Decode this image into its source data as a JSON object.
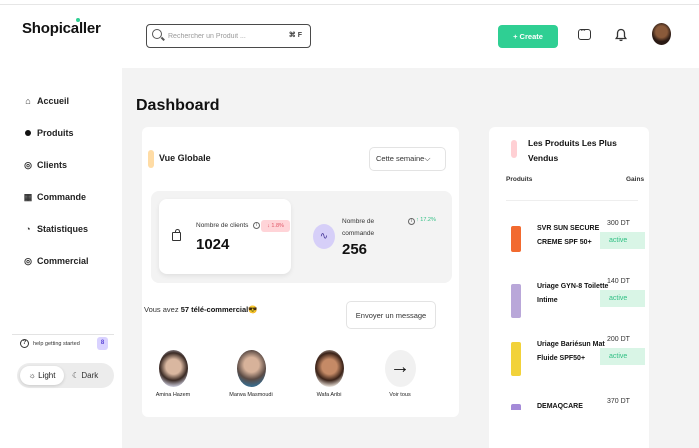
{
  "app": {
    "logo": "Shopicaller"
  },
  "sidebar": {
    "items": [
      {
        "label": "Accueil",
        "icon": "home-icon",
        "glyph": "⌂"
      },
      {
        "label": "Produits",
        "icon": "box-icon",
        "glyph": ""
      },
      {
        "label": "Clients",
        "icon": "user-icon",
        "glyph": "◎"
      },
      {
        "label": "Commande",
        "icon": "cart-icon",
        "glyph": "▦"
      },
      {
        "label": "Statistiques",
        "icon": "chart-icon",
        "glyph": "◔"
      },
      {
        "label": "Commercial",
        "icon": "person-icon",
        "glyph": "◎"
      }
    ],
    "active": "Produits",
    "help_label": "help getting started",
    "help_badge": "8",
    "theme_light": "☼ Light",
    "theme_dark": "☾ Dark"
  },
  "header": {
    "search_placeholder": "Rechercher un Produit ...",
    "search_shortcut": "⌘ F",
    "create_label": "+ Create"
  },
  "main": {
    "title": "Dashboard",
    "overview": {
      "title": "Vue Globale",
      "period": "Cette semaine",
      "stat1_label": "Nombre de clients",
      "stat1_change": "↓ 1.8%",
      "stat1_value": "1024",
      "stat2_label": "Nombre de commande",
      "stat2_change": "↑ 17.2%",
      "stat2_value": "256"
    },
    "tele": {
      "prefix": "Vous avez ",
      "count": "57 télé-commercial",
      "emoji": "😎"
    },
    "send_message": "Envoyer un message",
    "people": [
      {
        "name": "Amina Hazem"
      },
      {
        "name": "Marwa Masmoudi"
      },
      {
        "name": "Wafa Aribi"
      }
    ],
    "see_all": "Voir tous",
    "see_all_glyph": "→"
  },
  "products": {
    "title": "Les Produits Les Plus Vendus",
    "col_products": "Produits",
    "col_gains": "Gains",
    "items": [
      {
        "name": "SVR SUN SECURE CREME SPF 50+",
        "price": "300 DT",
        "status": "active",
        "color": "#f26a2f"
      },
      {
        "name": "Uriage GYN-8 Toilette Intime",
        "price": "140 DT",
        "status": "active",
        "color": "#b9a7d9"
      },
      {
        "name": "Uriage Bariésun Mat Fluide SPF50+",
        "price": "200 DT",
        "status": "active",
        "color": "#f2d23a"
      },
      {
        "name": "DEMAQCARE",
        "price": "370 DT",
        "status": "",
        "color": "#a48ad8"
      }
    ]
  },
  "colors": {
    "accent": "#2fcf93",
    "down": "#e05566",
    "up": "#2fbf83"
  }
}
